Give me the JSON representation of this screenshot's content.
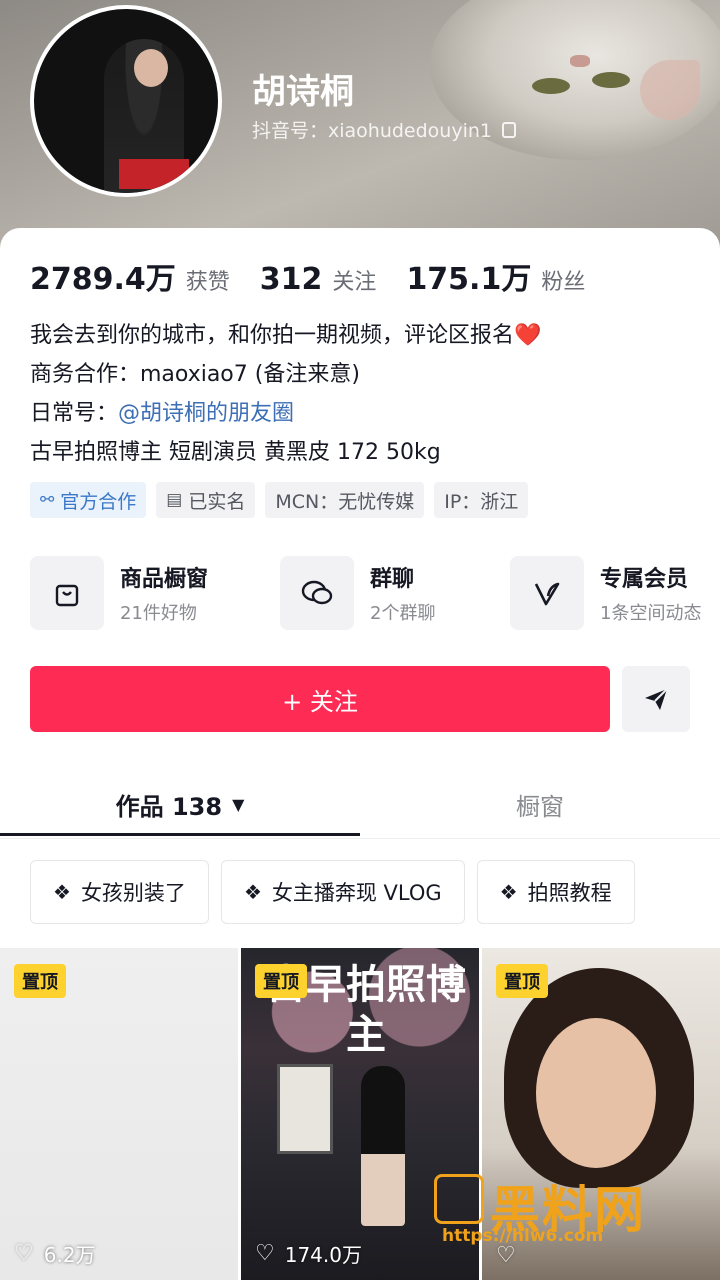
{
  "profile": {
    "name": "胡诗桐",
    "douyin_id": "抖音号：xiaohudedouyin1"
  },
  "stats": [
    {
      "num": "2789.4万",
      "label": "获赞"
    },
    {
      "num": "312",
      "label": "关注"
    },
    {
      "num": "175.1万",
      "label": "粉丝"
    }
  ],
  "bio": {
    "line1": "我会去到你的城市，和你拍一期视频，评论区报名",
    "line1_emoji": "❤️",
    "line2": "商务合作：maoxiao7 (备注来意)",
    "line3_prefix": "日常号：",
    "line3_link": "@胡诗桐的朋友圈",
    "line4": "古早拍照博主 短剧演员 黄黑皮 172 50kg"
  },
  "tags": [
    {
      "label": "官方合作",
      "icon": "handshake-icon"
    },
    {
      "label": "已实名",
      "icon": "id-card-icon"
    },
    {
      "label": "MCN：无忧传媒"
    },
    {
      "label": "IP：浙江"
    }
  ],
  "shortcuts": [
    {
      "title": "商品橱窗",
      "sub": "21件好物",
      "icon": "shopping-bag-icon"
    },
    {
      "title": "群聊",
      "sub": "2个群聊",
      "icon": "chat-bubbles-icon"
    },
    {
      "title": "专属会员",
      "sub": "1条空间动态",
      "icon": "v-badge-icon"
    }
  ],
  "actions": {
    "follow": "+ 关注",
    "share_icon": "send-icon"
  },
  "tabs": {
    "works": "作品 138",
    "works_caret": "▼",
    "shop": "橱窗"
  },
  "collections": [
    {
      "label": "女孩别装了",
      "icon": "stack-icon"
    },
    {
      "label": "女主播奔现 VLOG",
      "icon": "stack-icon"
    },
    {
      "label": "拍照教程",
      "icon": "stack-icon"
    }
  ],
  "videos": [
    {
      "pin": "置顶",
      "likes": "6.2万"
    },
    {
      "pin": "置顶",
      "likes": "174.0万",
      "overlay_title": "古早拍照博主"
    },
    {
      "pin": "置顶",
      "likes": ""
    }
  ],
  "watermark": {
    "text": "黑料网",
    "url": "https://hlw6.com"
  },
  "colors": {
    "accent": "#fe2c55",
    "link": "#3c6fb5",
    "pin_badge": "#fdd22e"
  }
}
